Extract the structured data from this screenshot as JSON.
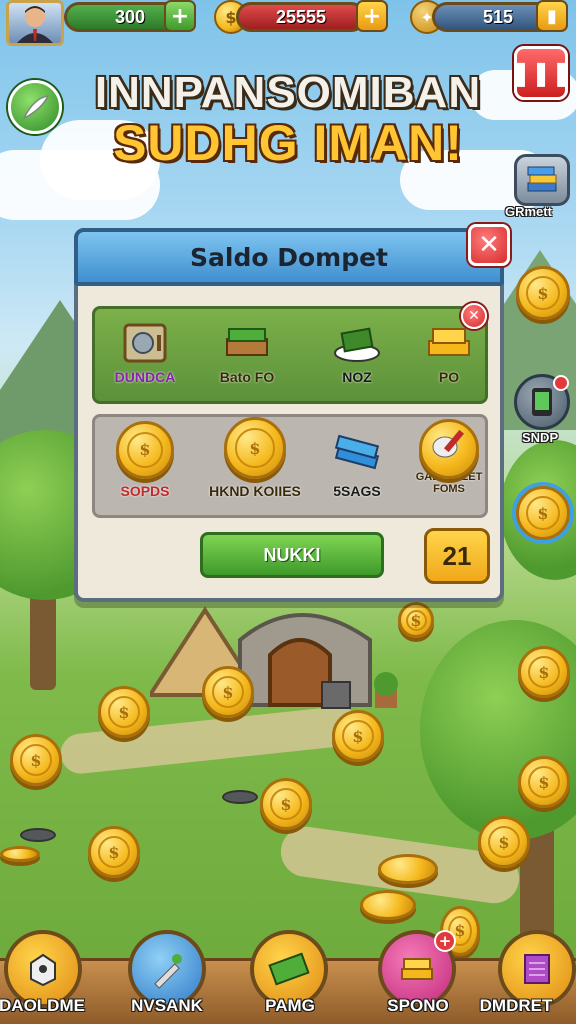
{
  "title": {
    "line1": "INNPANSOMIBAN",
    "line2": "SUDHG IMAN!"
  },
  "resources": {
    "gems": "300",
    "coins": "25555",
    "tokens": "515"
  },
  "side_right": {
    "gifts_label": "GRmett",
    "snd_label": "SNDP"
  },
  "dialog": {
    "title": "Saldo Dompet",
    "green_items": [
      "DUNDCA",
      "Bato FO",
      "NOZ",
      "PO"
    ],
    "grey_items": [
      "SOPDS",
      "HKND KOIIES",
      "5SAGS",
      "GAEFDELET FOMS"
    ],
    "action_label": "NUKKI",
    "count": "21"
  },
  "bottom_nav": [
    "DAOLDME",
    "NVSANK",
    "PAMG",
    "SPONO",
    "DMDRET"
  ],
  "colors": {
    "sky": "#7fc3ea",
    "grass": "#6aa83a",
    "gold": "#f5b81c",
    "action_green": "#3e9a2a",
    "close_red": "#d62c2c",
    "header_blue": "#3f8fcf"
  }
}
